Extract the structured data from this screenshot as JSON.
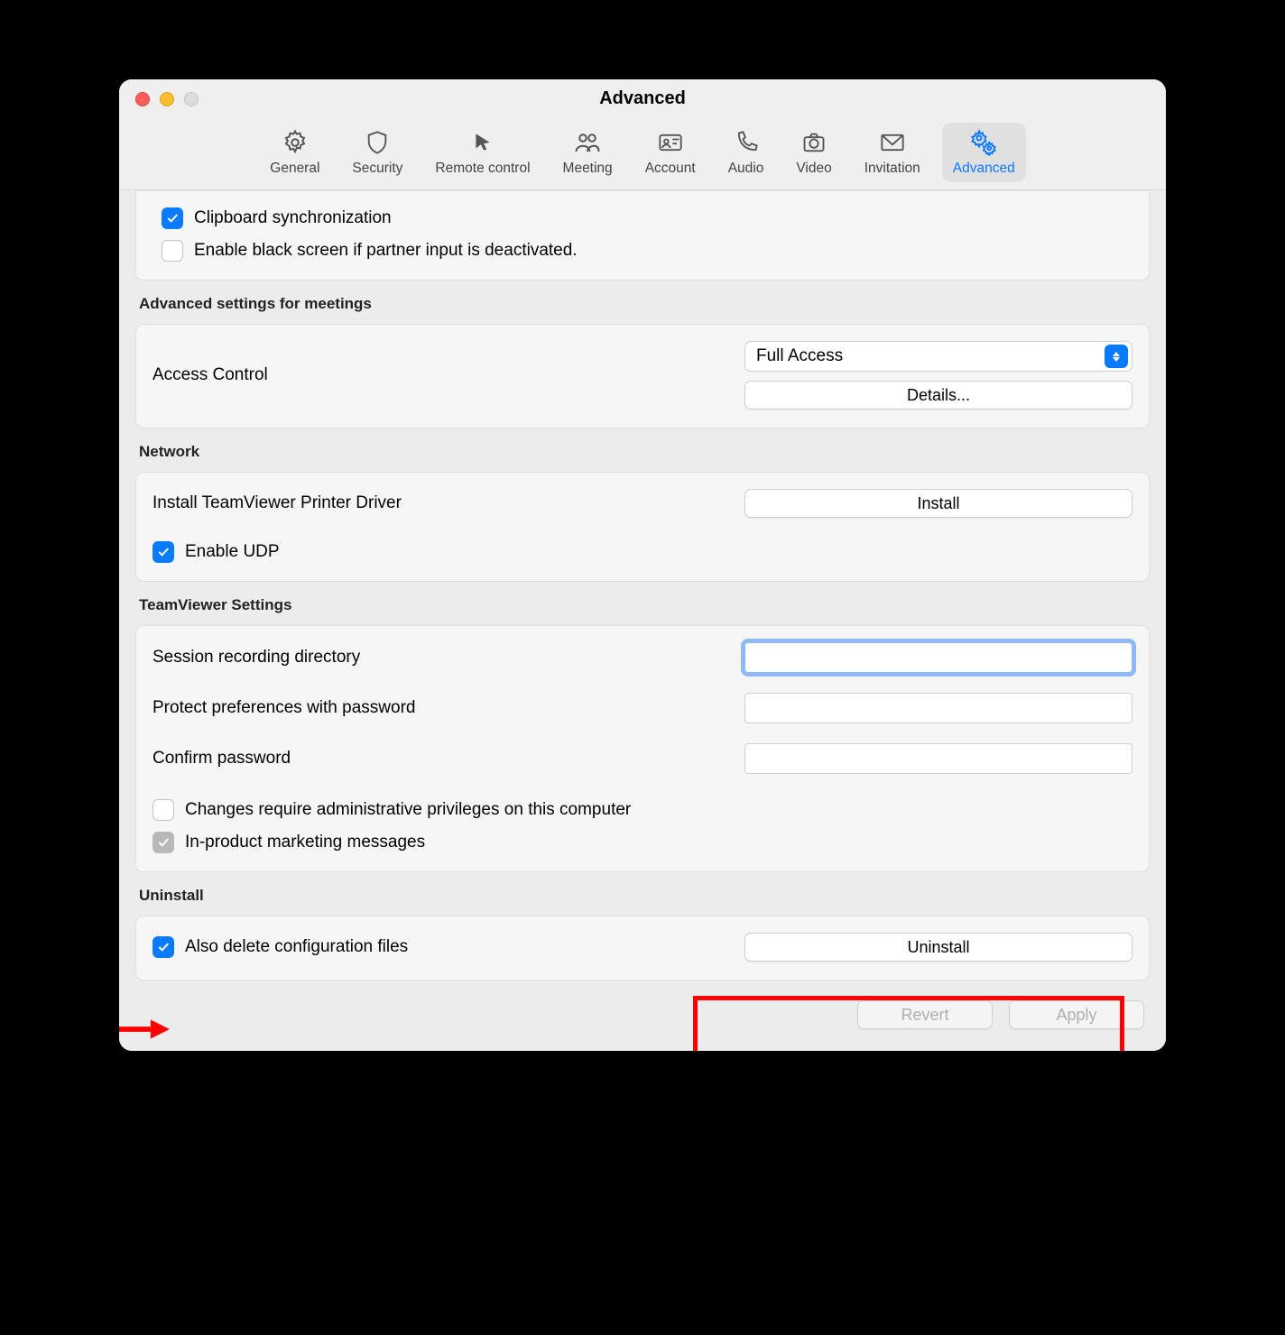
{
  "window": {
    "title": "Advanced"
  },
  "tabs": [
    {
      "key": "general",
      "label": "General"
    },
    {
      "key": "security",
      "label": "Security"
    },
    {
      "key": "remote",
      "label": "Remote control"
    },
    {
      "key": "meeting",
      "label": "Meeting"
    },
    {
      "key": "account",
      "label": "Account"
    },
    {
      "key": "audio",
      "label": "Audio"
    },
    {
      "key": "video",
      "label": "Video"
    },
    {
      "key": "invitation",
      "label": "Invitation"
    },
    {
      "key": "advanced",
      "label": "Advanced",
      "active": true
    }
  ],
  "top_panel": {
    "clipboard_sync": {
      "checked": true,
      "label": "Clipboard synchronization"
    },
    "black_screen": {
      "checked": false,
      "label": "Enable black screen if partner input is deactivated."
    }
  },
  "meetings": {
    "section_title": "Advanced settings for meetings",
    "access_control_label": "Access Control",
    "access_control_value": "Full Access",
    "details_button": "Details..."
  },
  "network": {
    "section_title": "Network",
    "install_printer_label": "Install TeamViewer Printer Driver",
    "install_button": "Install",
    "enable_udp": {
      "checked": true,
      "label": "Enable UDP"
    }
  },
  "tv_settings": {
    "section_title": "TeamViewer Settings",
    "session_dir_label": "Session recording directory",
    "session_dir_value": "",
    "protect_pw_label": "Protect preferences with password",
    "protect_pw_value": "",
    "confirm_pw_label": "Confirm password",
    "confirm_pw_value": "",
    "admin_priv": {
      "checked": false,
      "label": "Changes require administrative privileges on this computer"
    },
    "marketing": {
      "checked": true,
      "disabled": true,
      "label": "In-product marketing messages"
    }
  },
  "uninstall": {
    "section_title": "Uninstall",
    "delete_config": {
      "checked": true,
      "label": "Also delete configuration files"
    },
    "uninstall_button": "Uninstall"
  },
  "footer": {
    "revert": "Revert",
    "apply": "Apply"
  }
}
